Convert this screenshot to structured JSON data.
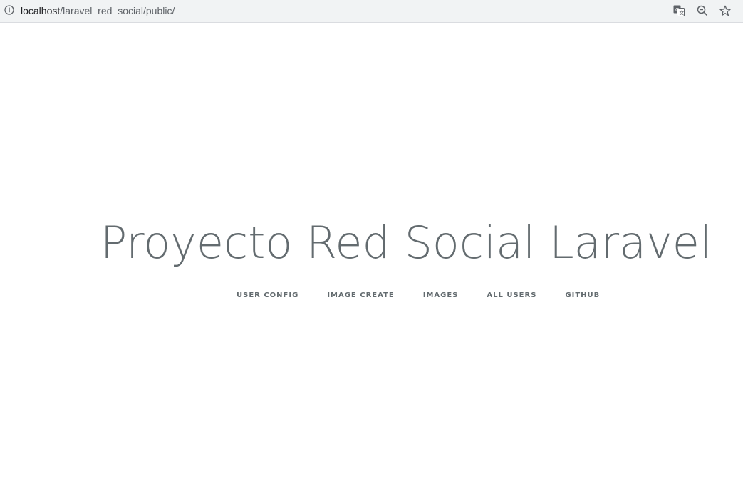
{
  "browser": {
    "url_host": "localhost",
    "url_path": "/laravel_red_social/public/",
    "icons": {
      "info": "info-icon",
      "translate": "translate-icon",
      "zoom": "zoom-out-icon",
      "bookmark": "star-icon"
    }
  },
  "page": {
    "title": "Proyecto Red Social Laravel",
    "links": [
      {
        "label": "USER CONFIG"
      },
      {
        "label": "IMAGE CREATE"
      },
      {
        "label": "IMAGES"
      },
      {
        "label": "ALL USERS"
      },
      {
        "label": "GITHUB"
      }
    ]
  },
  "colors": {
    "text": "#636b6f",
    "background": "#ffffff",
    "toolbar": "#f1f3f4"
  }
}
